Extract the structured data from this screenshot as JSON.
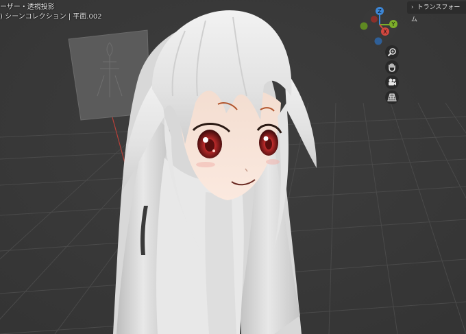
{
  "viewport": {
    "mode_label": "ーザー・透視投影",
    "collection_label": ") シーンコレクション | 平面.002"
  },
  "sidebar": {
    "transform_tab": "トランスフォーム"
  },
  "gizmo": {
    "z_label": "Z",
    "y_label": "Y",
    "x_label": "X"
  },
  "nav_buttons": [
    "zoom-icon",
    "hand-pan-icon",
    "camera-icon",
    "grid-perspective-icon"
  ],
  "colors": {
    "viewport_bg": "#3a3a3a",
    "grid_line": "#4a4a4a",
    "axis_x": "#d2473f",
    "axis_y": "#7cad2a",
    "axis_z": "#3c86d6",
    "hair": "#e4e4e4",
    "skin": "#f5e2d6",
    "eye": "#9c1e1e"
  }
}
